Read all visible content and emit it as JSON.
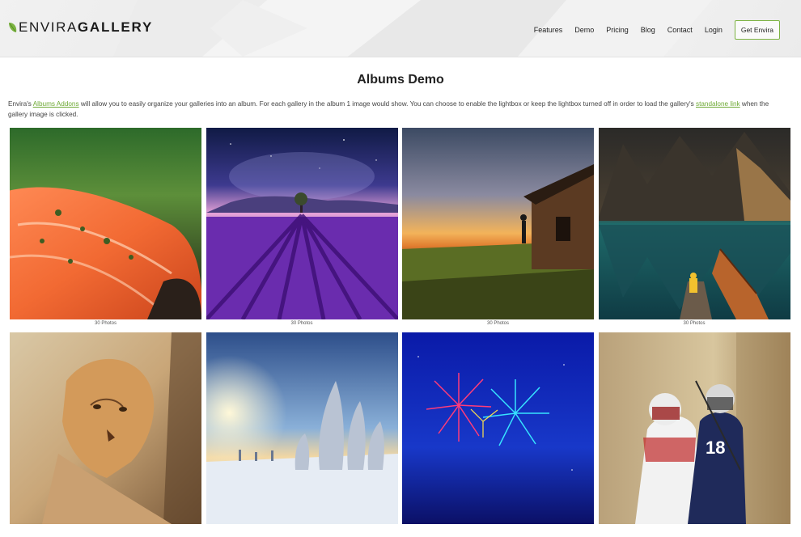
{
  "brand": {
    "logo_light": "ENVIRA",
    "logo_bold": "GALLERY"
  },
  "nav": {
    "items": [
      "Features",
      "Demo",
      "Pricing",
      "Blog",
      "Contact",
      "Login"
    ],
    "cta": "Get Envira"
  },
  "page": {
    "title": "Albums Demo",
    "intro": {
      "part1": "Envira's ",
      "link1": "Albums Addons",
      "part2": " will allow you to easily organize your galleries into an album. For each gallery in the album 1 image would show. You can choose to enable the lightbox or keep the lightbox turned off in order to load the gallery's ",
      "link2": "standalone link",
      "part3": " when the gallery image is clicked."
    }
  },
  "albums": [
    {
      "caption": "30 Photos",
      "icon": "salmon-image"
    },
    {
      "caption": "30 Photos",
      "icon": "lavender-field-image"
    },
    {
      "caption": "30 Photos",
      "icon": "cabin-sunset-image"
    },
    {
      "caption": "30 Photos",
      "icon": "mountain-lake-boat-image"
    },
    {
      "caption": "",
      "icon": "lioness-image"
    },
    {
      "caption": "",
      "icon": "snowy-trees-image"
    },
    {
      "caption": "",
      "icon": "fireworks-image"
    },
    {
      "caption": "",
      "icon": "lacrosse-players-image"
    }
  ],
  "colors": {
    "accent": "#7cb342",
    "link": "#6ea935"
  }
}
